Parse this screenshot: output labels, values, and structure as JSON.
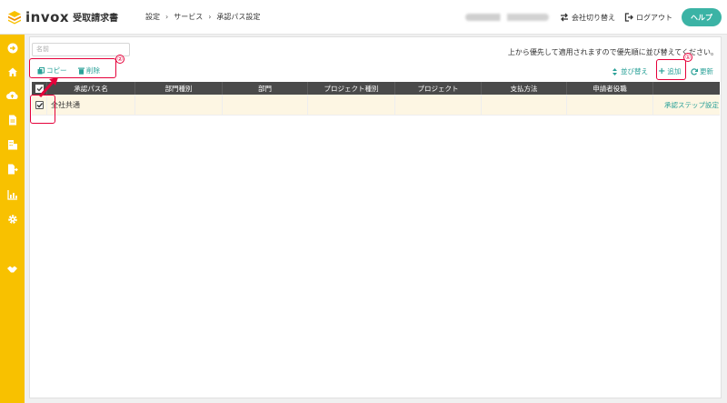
{
  "header": {
    "logo_word": "invox",
    "logo_sub": "受取請求書",
    "breadcrumb": [
      "設定",
      "サービス",
      "承認パス設定"
    ],
    "switch_company": "会社切り替え",
    "logout": "ログアウト",
    "help": "ヘルプ"
  },
  "sidebar": {
    "icons": [
      "arrow-right-circle-icon",
      "home-icon",
      "cloud-upload-icon",
      "document-icon",
      "building-icon",
      "document-export-icon",
      "chart-icon",
      "gear-icon",
      "handshake-icon"
    ]
  },
  "filters": {
    "name_placeholder": "名前"
  },
  "toolbar": {
    "copy": "コピー",
    "delete": "削除",
    "sort": "並び替え",
    "add": "追加",
    "refresh": "更新",
    "priority_note": "上から優先して適用されますので優先順に並び替えてください。"
  },
  "table": {
    "columns": [
      "承認パス名",
      "部門種別",
      "部門",
      "プロジェクト種別",
      "プロジェクト",
      "支払方法",
      "申請者役職",
      ""
    ],
    "rows": [
      {
        "checked": true,
        "name": "全社共通",
        "dept_type": "",
        "dept": "",
        "project_type": "",
        "project": "",
        "payment": "",
        "role": "",
        "action": "承認ステップ設定"
      }
    ]
  },
  "annotations": {
    "badge_1": "①",
    "badge_2": "②"
  },
  "colors": {
    "accent": "#3bb3a5",
    "sidebar": "#f8c100",
    "table_header": "#4a4a4a",
    "row_highlight": "#fdf6e3",
    "annotation": "#e5003a"
  }
}
